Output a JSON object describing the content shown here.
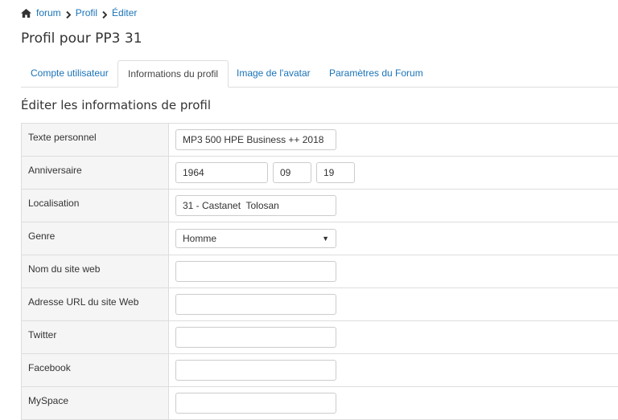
{
  "breadcrumb": {
    "items": [
      "forum",
      "Profil",
      "Éditer"
    ]
  },
  "page_title": "Profil pour PP3 31",
  "tabs": [
    {
      "label": "Compte utilisateur",
      "active": false
    },
    {
      "label": "Informations du profil",
      "active": true
    },
    {
      "label": "Image de l'avatar",
      "active": false
    },
    {
      "label": "Paramètres du Forum",
      "active": false
    }
  ],
  "section_title": "Éditer les informations de profil",
  "form": {
    "personal_text": {
      "label": "Texte personnel",
      "value": "MP3 500 HPE Business ++ 2018"
    },
    "birthday": {
      "label": "Anniversaire",
      "year": "1964",
      "month": "09",
      "day": "19"
    },
    "location": {
      "label": "Localisation",
      "value": "31 - Castanet  Tolosan"
    },
    "gender": {
      "label": "Genre",
      "value": "Homme"
    },
    "website_name": {
      "label": "Nom du site web",
      "value": ""
    },
    "website_url": {
      "label": "Adresse URL du site Web",
      "value": ""
    },
    "twitter": {
      "label": "Twitter",
      "value": ""
    },
    "facebook": {
      "label": "Facebook",
      "value": ""
    },
    "myspace": {
      "label": "MySpace",
      "value": ""
    }
  },
  "colors": {
    "link": "#1a73b8",
    "border": "#dddddd",
    "label_bg": "#f5f5f5"
  }
}
